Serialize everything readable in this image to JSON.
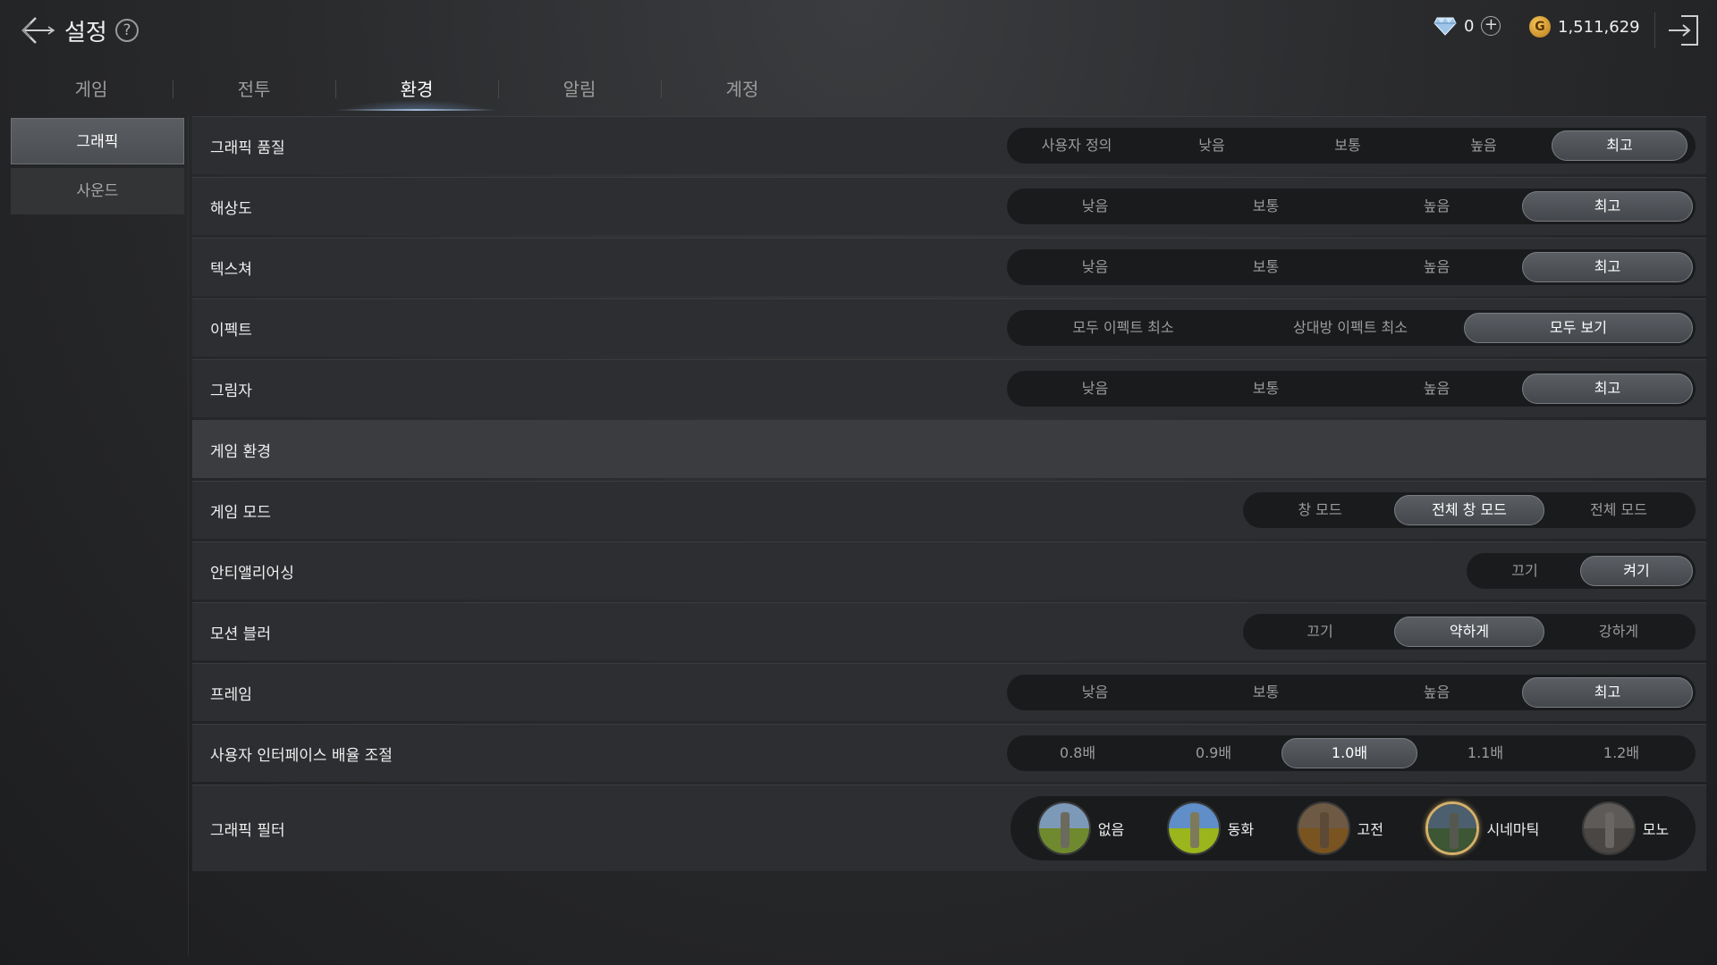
{
  "header": {
    "title": "설정",
    "help_label": "?",
    "gems": "0",
    "gold": "1,511,629",
    "gold_symbol": "G",
    "plus_label": "+"
  },
  "tabs": [
    {
      "label": "게임",
      "active": false
    },
    {
      "label": "전투",
      "active": false
    },
    {
      "label": "환경",
      "active": true
    },
    {
      "label": "알림",
      "active": false
    },
    {
      "label": "계정",
      "active": false
    }
  ],
  "sidebar": {
    "items": [
      {
        "label": "그래픽",
        "active": true
      },
      {
        "label": "사운드",
        "active": false
      }
    ]
  },
  "settings": {
    "graphics_quality": {
      "label": "그래픽 품질",
      "options": [
        "사용자 정의",
        "낮음",
        "보통",
        "높음",
        "최고"
      ],
      "selected": "최고"
    },
    "resolution": {
      "label": "해상도",
      "options": [
        "낮음",
        "보통",
        "높음",
        "최고"
      ],
      "selected": "최고"
    },
    "texture": {
      "label": "텍스쳐",
      "options": [
        "낮음",
        "보통",
        "높음",
        "최고"
      ],
      "selected": "최고"
    },
    "effect": {
      "label": "이펙트",
      "options": [
        "모두 이펙트 최소",
        "상대방 이펙트 최소",
        "모두 보기"
      ],
      "selected": "모두 보기"
    },
    "shadow": {
      "label": "그림자",
      "options": [
        "낮음",
        "보통",
        "높음",
        "최고"
      ],
      "selected": "최고"
    },
    "section_game_env": "게임 환경",
    "game_mode": {
      "label": "게임 모드",
      "options": [
        "창 모드",
        "전체 창 모드",
        "전체 모드"
      ],
      "selected": "전체 창 모드"
    },
    "anti_aliasing": {
      "label": "안티앨리어싱",
      "options": [
        "끄기",
        "켜기"
      ],
      "selected": "켜기"
    },
    "motion_blur": {
      "label": "모션 블러",
      "options": [
        "끄기",
        "약하게",
        "강하게"
      ],
      "selected": "약하게"
    },
    "frame": {
      "label": "프레임",
      "options": [
        "낮음",
        "보통",
        "높음",
        "최고"
      ],
      "selected": "최고"
    },
    "ui_scale": {
      "label": "사용자 인터페이스 배율 조절",
      "options": [
        "0.8배",
        "0.9배",
        "1.0배",
        "1.1배",
        "1.2배"
      ],
      "selected": "1.0배"
    },
    "graphic_filter": {
      "label": "그래픽 필터",
      "options": [
        "없음",
        "동화",
        "고전",
        "시네마틱",
        "모노"
      ],
      "selected": "시네마틱"
    }
  },
  "colors": {
    "accent_gold": "#d4b06a",
    "tab_glow": "#9fb8d8"
  }
}
